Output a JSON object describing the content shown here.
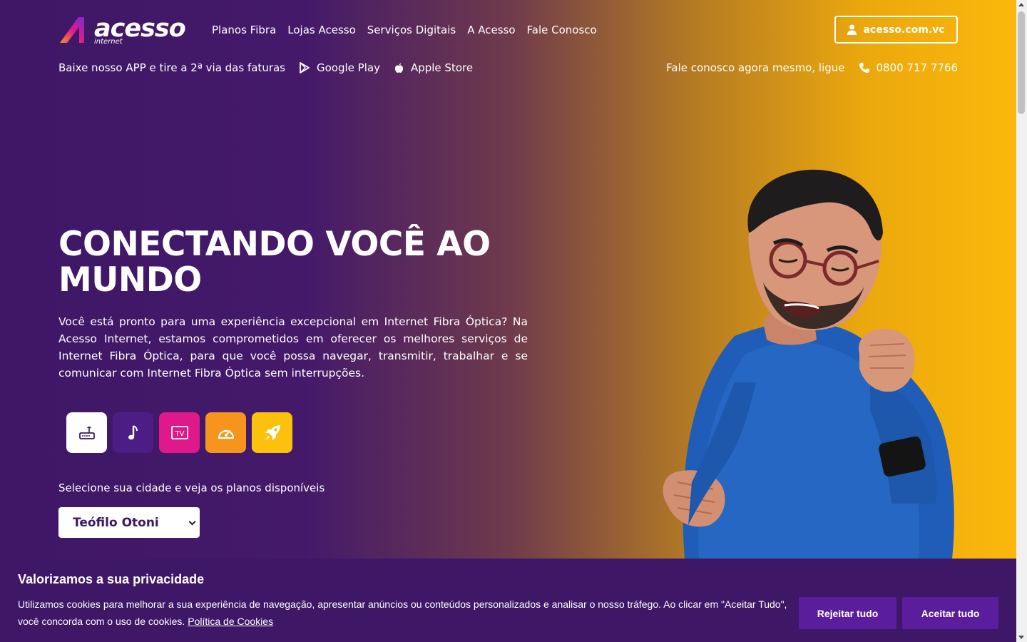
{
  "header": {
    "logo": {
      "name": "acesso",
      "sub": "internet"
    },
    "nav": [
      "Planos Fibra",
      "Lojas Acesso",
      "Serviços Digitais",
      "A Acesso",
      "Fale Conosco"
    ],
    "login_label": "acesso.com.vc"
  },
  "subbar": {
    "app_text": "Baixe nosso APP e tire a 2ª via das faturas",
    "google_play": "Google Play",
    "apple_store": "Apple Store",
    "contact_text": "Fale conosco agora mesmo, ligue",
    "phone": "0800 717 7766"
  },
  "hero": {
    "title": "CONECTANDO VOCÊ AO MUNDO",
    "text": "Você está pronto para uma experiência excepcional em Internet Fibra Óptica? Na Acesso Internet, estamos comprometidos em oferecer os melhores serviços de Internet Fibra Óptica, para que você possa navegar, transmitir, trabalhar e se comunicar com Internet Fibra Óptica sem interrupções.",
    "services": [
      {
        "icon": "router-icon",
        "color": "#ffffff"
      },
      {
        "icon": "music-icon",
        "color": "#4b1d85"
      },
      {
        "icon": "tv-icon",
        "color": "#e0198a"
      },
      {
        "icon": "speedometer-icon",
        "color": "#f7941d"
      },
      {
        "icon": "rocket-icon",
        "color": "#fbc10d"
      }
    ],
    "city_label": "Selecione sua cidade e veja os planos disponíveis",
    "city_selected": "Teófilo Otoni"
  },
  "cookie": {
    "title": "Valorizamos a sua privacidade",
    "text": "Utilizamos cookies para melhorar a sua experiência de navegação, apresentar anúncios ou conteúdos personalizados e analisar o nosso tráfego. Ao clicar em \"Aceitar Tudo\", você concorda com o uso de cookies.",
    "policy_link": "Política de Cookies",
    "reject_label": "Rejeitar tudo",
    "accept_label": "Aceitar tudo"
  },
  "colors": {
    "brand_purple": "#3e1766",
    "brand_yellow": "#fbb80b",
    "button_purple": "#5a1d9e"
  }
}
